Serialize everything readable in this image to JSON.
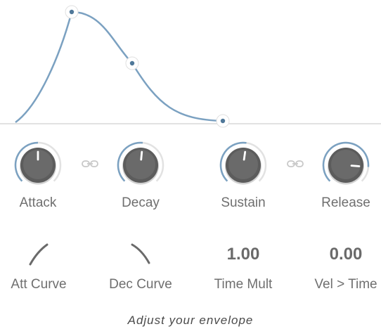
{
  "knobs": [
    {
      "label": "Attack",
      "value": 0.5
    },
    {
      "label": "Decay",
      "value": 0.52
    },
    {
      "label": "Sustain",
      "value": 0.53
    },
    {
      "label": "Release",
      "value": 0.85
    }
  ],
  "link_icons": [
    "link-icon",
    "link-icon"
  ],
  "curves": [
    {
      "label": "Att Curve",
      "icon": "curve-rising-icon"
    },
    {
      "label": "Dec Curve",
      "icon": "curve-falling-icon"
    }
  ],
  "time_mult": {
    "label": "Time Mult",
    "value": "1.00"
  },
  "vel_time": {
    "label": "Vel > Time",
    "value": "0.00"
  },
  "footer": "Adjust your envelope",
  "colors": {
    "accent": "#7ba1c1",
    "knob_body": "#5c5c5c",
    "ring_track": "#e2e2e2",
    "baseline": "#d0d0d0",
    "text": "#6f6f6f"
  }
}
